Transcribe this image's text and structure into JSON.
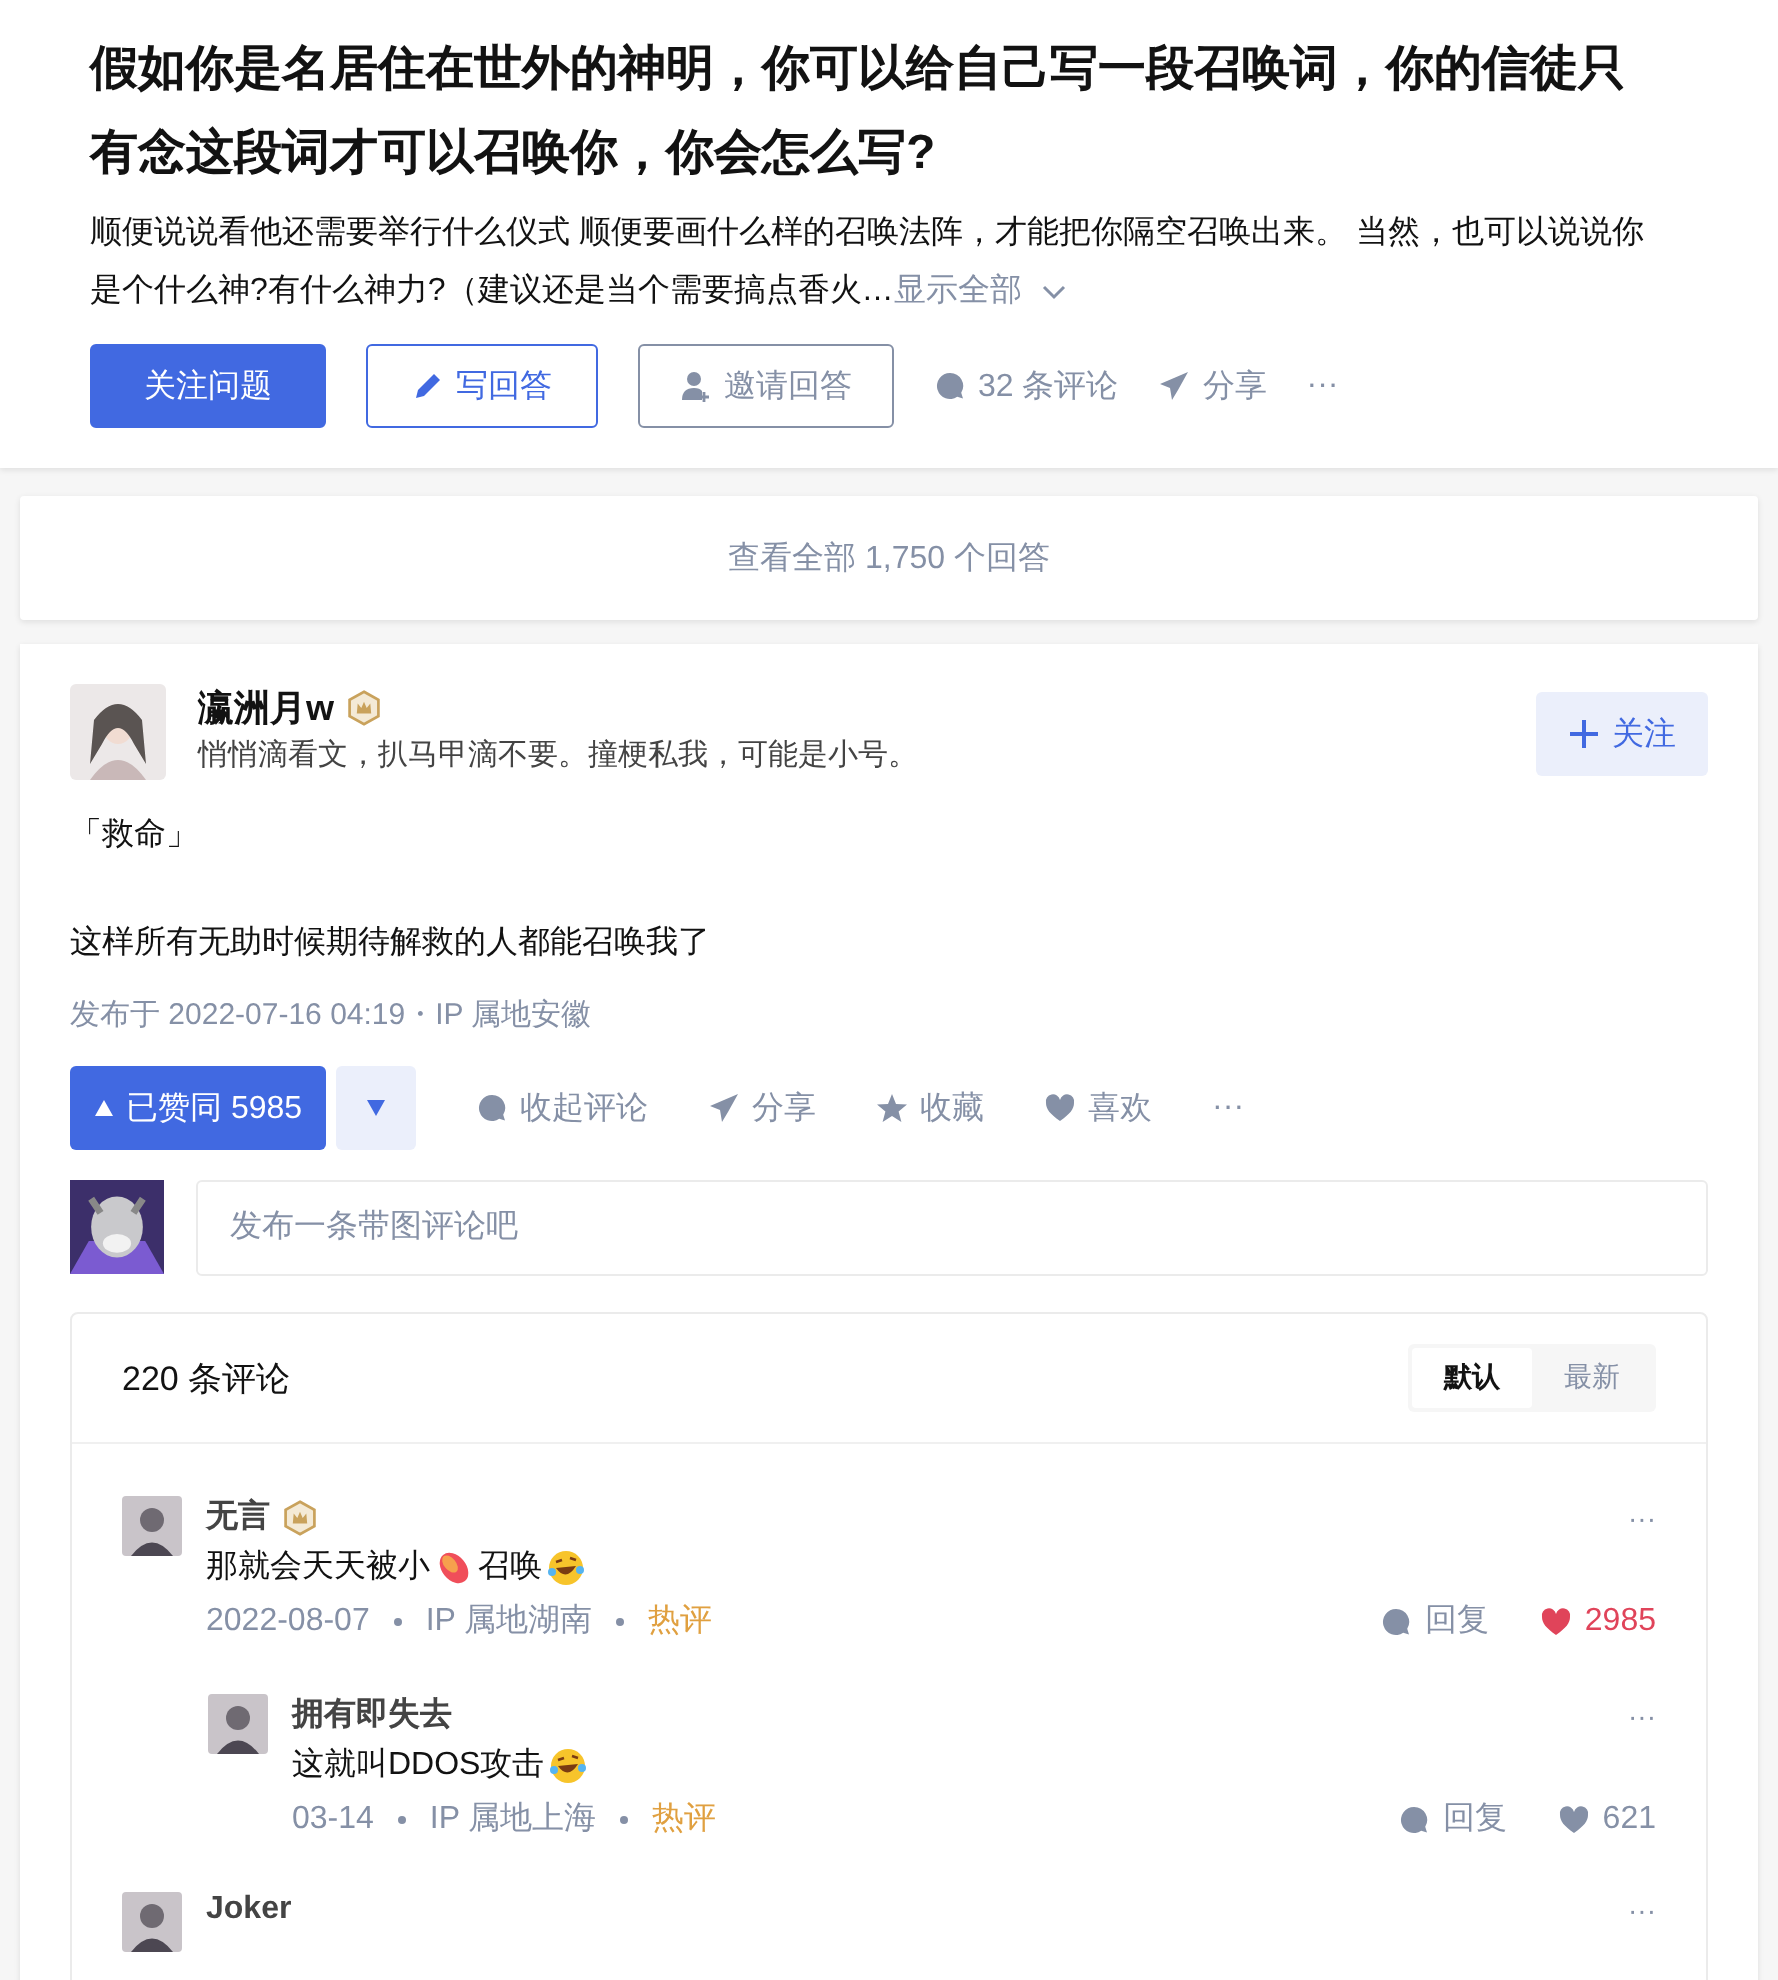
{
  "question": {
    "title": "假如你是名居住在世外的神明，你可以给自己写一段召唤词，你的信徒只有念这段词才可以召唤你，你会怎么写?",
    "detail": "顺便说说看他还需要举行什么仪式 顺便要画什么样的召唤法阵，才能把你隔空召唤出来。 当然，也可以说说你是个什么神?有什么神力?（建议还是当个需要搞点香火…",
    "show_all": "显示全部",
    "follow": "关注问题",
    "write": "写回答",
    "invite": "邀请回答",
    "comments": "32 条评论",
    "share": "分享",
    "more": "···"
  },
  "view_all": "查看全部 1,750 个回答",
  "answer": {
    "author": "瀛洲月w",
    "badge": true,
    "bio": "悄悄滴看文，扒马甲滴不要。撞梗私我，可能是小号。",
    "follow": "关注",
    "paragraphs": [
      "「救命」",
      "这样所有无助时候期待解救的人都能召唤我了"
    ],
    "meta": "发布于 2022-07-16 04:19・IP 属地安徽",
    "vote": {
      "label": "已赞同 5985",
      "selected": true
    },
    "actions": [
      "收起评论",
      "分享",
      "收藏",
      "喜欢"
    ],
    "more": "···",
    "comment_placeholder": "发布一条带图评论吧",
    "comments_panel": {
      "count": "220 条评论",
      "sorts": [
        {
          "label": "默认",
          "selected": true
        },
        {
          "label": "最新",
          "selected": false
        }
      ],
      "comments": [
        {
          "name": "无言",
          "badge": true,
          "parts": [
            {
              "kind": "text",
              "text": "那就会天天被小"
            },
            {
              "kind": "peach"
            },
            {
              "kind": "text",
              "text": "召唤"
            },
            {
              "kind": "laugh"
            }
          ],
          "date": "2022-08-07",
          "ip": "IP 属地湖南",
          "hot": "热评",
          "reply": "回复",
          "likes": "2985",
          "liked": true,
          "more": "···",
          "children": [
            {
              "name": "拥有即失去",
              "badge": false,
              "parts": [
                {
                  "kind": "text",
                  "text": "这就叫DDOS攻击"
                },
                {
                  "kind": "laugh"
                }
              ],
              "date": "03-14",
              "ip": "IP 属地上海",
              "hot": "热评",
              "reply": "回复",
              "likes": "621",
              "liked": false,
              "more": "···"
            }
          ]
        },
        {
          "name": "Joker",
          "badge": false,
          "more": "···"
        }
      ]
    }
  }
}
